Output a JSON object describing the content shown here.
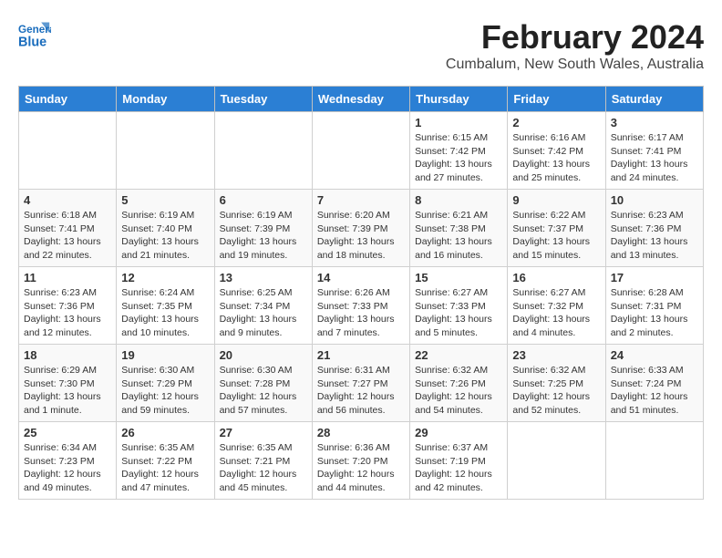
{
  "app": {
    "name": "GeneralBlue",
    "logo_text_line1": "General",
    "logo_text_line2": "Blue"
  },
  "header": {
    "month_year": "February 2024",
    "location": "Cumbalum, New South Wales, Australia"
  },
  "weekdays": [
    "Sunday",
    "Monday",
    "Tuesday",
    "Wednesday",
    "Thursday",
    "Friday",
    "Saturday"
  ],
  "weeks": [
    [
      {
        "day": "",
        "info": ""
      },
      {
        "day": "",
        "info": ""
      },
      {
        "day": "",
        "info": ""
      },
      {
        "day": "",
        "info": ""
      },
      {
        "day": "1",
        "info": "Sunrise: 6:15 AM\nSunset: 7:42 PM\nDaylight: 13 hours\nand 27 minutes."
      },
      {
        "day": "2",
        "info": "Sunrise: 6:16 AM\nSunset: 7:42 PM\nDaylight: 13 hours\nand 25 minutes."
      },
      {
        "day": "3",
        "info": "Sunrise: 6:17 AM\nSunset: 7:41 PM\nDaylight: 13 hours\nand 24 minutes."
      }
    ],
    [
      {
        "day": "4",
        "info": "Sunrise: 6:18 AM\nSunset: 7:41 PM\nDaylight: 13 hours\nand 22 minutes."
      },
      {
        "day": "5",
        "info": "Sunrise: 6:19 AM\nSunset: 7:40 PM\nDaylight: 13 hours\nand 21 minutes."
      },
      {
        "day": "6",
        "info": "Sunrise: 6:19 AM\nSunset: 7:39 PM\nDaylight: 13 hours\nand 19 minutes."
      },
      {
        "day": "7",
        "info": "Sunrise: 6:20 AM\nSunset: 7:39 PM\nDaylight: 13 hours\nand 18 minutes."
      },
      {
        "day": "8",
        "info": "Sunrise: 6:21 AM\nSunset: 7:38 PM\nDaylight: 13 hours\nand 16 minutes."
      },
      {
        "day": "9",
        "info": "Sunrise: 6:22 AM\nSunset: 7:37 PM\nDaylight: 13 hours\nand 15 minutes."
      },
      {
        "day": "10",
        "info": "Sunrise: 6:23 AM\nSunset: 7:36 PM\nDaylight: 13 hours\nand 13 minutes."
      }
    ],
    [
      {
        "day": "11",
        "info": "Sunrise: 6:23 AM\nSunset: 7:36 PM\nDaylight: 13 hours\nand 12 minutes."
      },
      {
        "day": "12",
        "info": "Sunrise: 6:24 AM\nSunset: 7:35 PM\nDaylight: 13 hours\nand 10 minutes."
      },
      {
        "day": "13",
        "info": "Sunrise: 6:25 AM\nSunset: 7:34 PM\nDaylight: 13 hours\nand 9 minutes."
      },
      {
        "day": "14",
        "info": "Sunrise: 6:26 AM\nSunset: 7:33 PM\nDaylight: 13 hours\nand 7 minutes."
      },
      {
        "day": "15",
        "info": "Sunrise: 6:27 AM\nSunset: 7:33 PM\nDaylight: 13 hours\nand 5 minutes."
      },
      {
        "day": "16",
        "info": "Sunrise: 6:27 AM\nSunset: 7:32 PM\nDaylight: 13 hours\nand 4 minutes."
      },
      {
        "day": "17",
        "info": "Sunrise: 6:28 AM\nSunset: 7:31 PM\nDaylight: 13 hours\nand 2 minutes."
      }
    ],
    [
      {
        "day": "18",
        "info": "Sunrise: 6:29 AM\nSunset: 7:30 PM\nDaylight: 13 hours\nand 1 minute."
      },
      {
        "day": "19",
        "info": "Sunrise: 6:30 AM\nSunset: 7:29 PM\nDaylight: 12 hours\nand 59 minutes."
      },
      {
        "day": "20",
        "info": "Sunrise: 6:30 AM\nSunset: 7:28 PM\nDaylight: 12 hours\nand 57 minutes."
      },
      {
        "day": "21",
        "info": "Sunrise: 6:31 AM\nSunset: 7:27 PM\nDaylight: 12 hours\nand 56 minutes."
      },
      {
        "day": "22",
        "info": "Sunrise: 6:32 AM\nSunset: 7:26 PM\nDaylight: 12 hours\nand 54 minutes."
      },
      {
        "day": "23",
        "info": "Sunrise: 6:32 AM\nSunset: 7:25 PM\nDaylight: 12 hours\nand 52 minutes."
      },
      {
        "day": "24",
        "info": "Sunrise: 6:33 AM\nSunset: 7:24 PM\nDaylight: 12 hours\nand 51 minutes."
      }
    ],
    [
      {
        "day": "25",
        "info": "Sunrise: 6:34 AM\nSunset: 7:23 PM\nDaylight: 12 hours\nand 49 minutes."
      },
      {
        "day": "26",
        "info": "Sunrise: 6:35 AM\nSunset: 7:22 PM\nDaylight: 12 hours\nand 47 minutes."
      },
      {
        "day": "27",
        "info": "Sunrise: 6:35 AM\nSunset: 7:21 PM\nDaylight: 12 hours\nand 45 minutes."
      },
      {
        "day": "28",
        "info": "Sunrise: 6:36 AM\nSunset: 7:20 PM\nDaylight: 12 hours\nand 44 minutes."
      },
      {
        "day": "29",
        "info": "Sunrise: 6:37 AM\nSunset: 7:19 PM\nDaylight: 12 hours\nand 42 minutes."
      },
      {
        "day": "",
        "info": ""
      },
      {
        "day": "",
        "info": ""
      }
    ]
  ]
}
